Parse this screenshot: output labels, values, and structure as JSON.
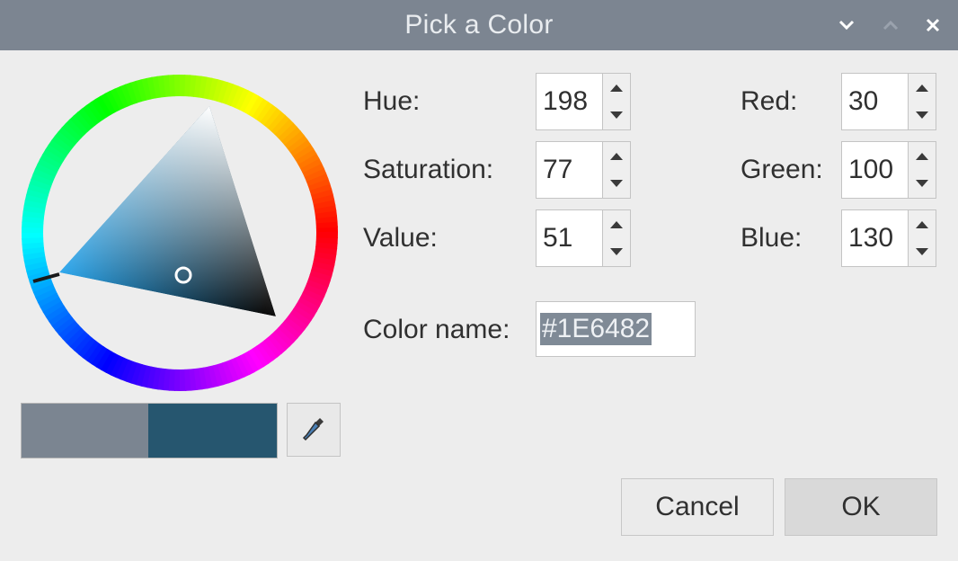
{
  "window": {
    "title": "Pick a Color",
    "buttons": {
      "minimize": "chevron-down-icon",
      "maximize": "chevron-up-icon",
      "close": "close-icon"
    }
  },
  "hsv": {
    "hue_label": "Hue:",
    "hue": "198",
    "saturation_label": "Saturation:",
    "saturation": "77",
    "value_label": "Value:",
    "value": "51"
  },
  "rgb": {
    "red_label": "Red:",
    "red": "30",
    "green_label": "Green:",
    "green": "100",
    "blue_label": "Blue:",
    "blue": "130"
  },
  "color_name": {
    "label": "Color name:",
    "value": "#1E6482"
  },
  "colors": {
    "previous": "#7b8591",
    "current": "#26566f",
    "selection_bg": "#7f8a96"
  },
  "actions": {
    "cancel": "Cancel",
    "ok": "OK"
  },
  "eyedropper": "eyedropper-icon"
}
